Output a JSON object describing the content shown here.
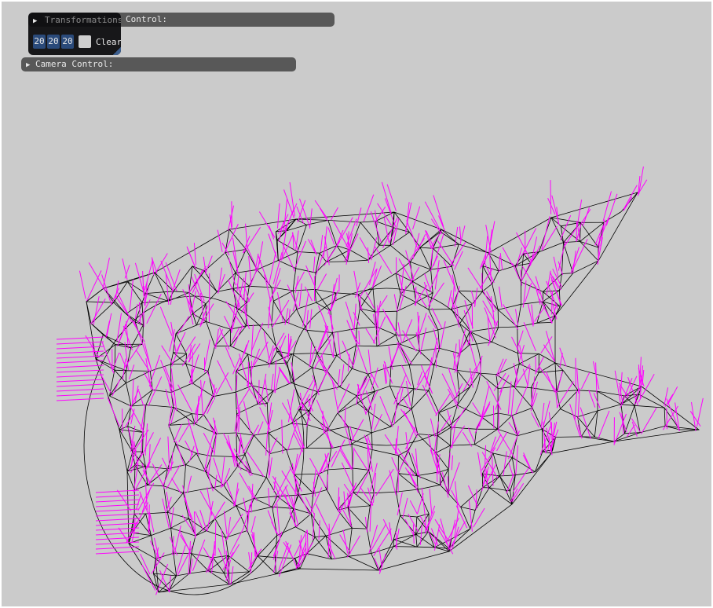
{
  "panels": {
    "transformations": {
      "label": "Transformations Control:",
      "collapsed": true
    },
    "camera": {
      "label": "Camera Control:",
      "collapsed": true
    }
  },
  "overlay": {
    "title": "Transformations",
    "resolution": [
      "20",
      "20",
      "20"
    ],
    "clear_label": "Clear"
  },
  "icons": {
    "collapse": "triangle-right-icon"
  },
  "colors": {
    "background": "#cbcbcb",
    "wireframe": "#000000",
    "normals": "#ff00ff",
    "panel": "#373737",
    "field": "#2a4a7a"
  }
}
